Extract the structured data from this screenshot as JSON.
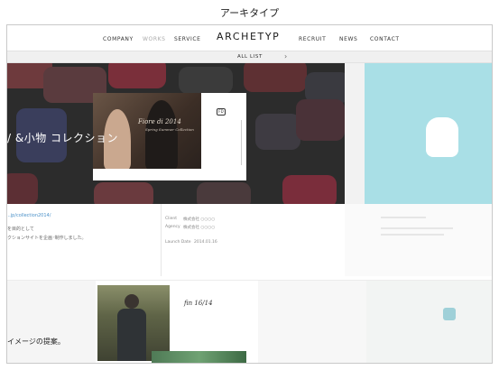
{
  "caption": "アーキタイプ",
  "nav": {
    "logo": "ARCHETYP",
    "items": [
      "COMPANY",
      "WORKS",
      "SERVICE",
      "RECRUIT",
      "NEWS",
      "CONTACT"
    ],
    "active": "WORKS"
  },
  "all_list": {
    "label": "ALL LIST",
    "chevron": "›"
  },
  "hero": {
    "title": "/ &小物 コレクション",
    "card_script": "Fiore di 2014",
    "card_script_sub": "Spring Summer Collection",
    "card_logo": "FD"
  },
  "info": {
    "link": "...jp/collection2014/",
    "desc_line1": "を目的として",
    "desc_line2": "クションサイトを企画･制作しました。",
    "meta": [
      {
        "label": "Client",
        "value": "株式会社 ○○○○"
      },
      {
        "label": "Agency",
        "value": "株式会社 ○○○○"
      },
      {
        "label": "Launch Date",
        "value": "2014.01.16"
      }
    ]
  },
  "bottom": {
    "text": "イメージの提案。",
    "script": "fin 16/14"
  },
  "colors": {
    "hero_bg": "#2c2c2c",
    "side_bg": "#a9dfe6",
    "link": "#4a90c8",
    "allbar_bg": "#f0f0f0"
  }
}
